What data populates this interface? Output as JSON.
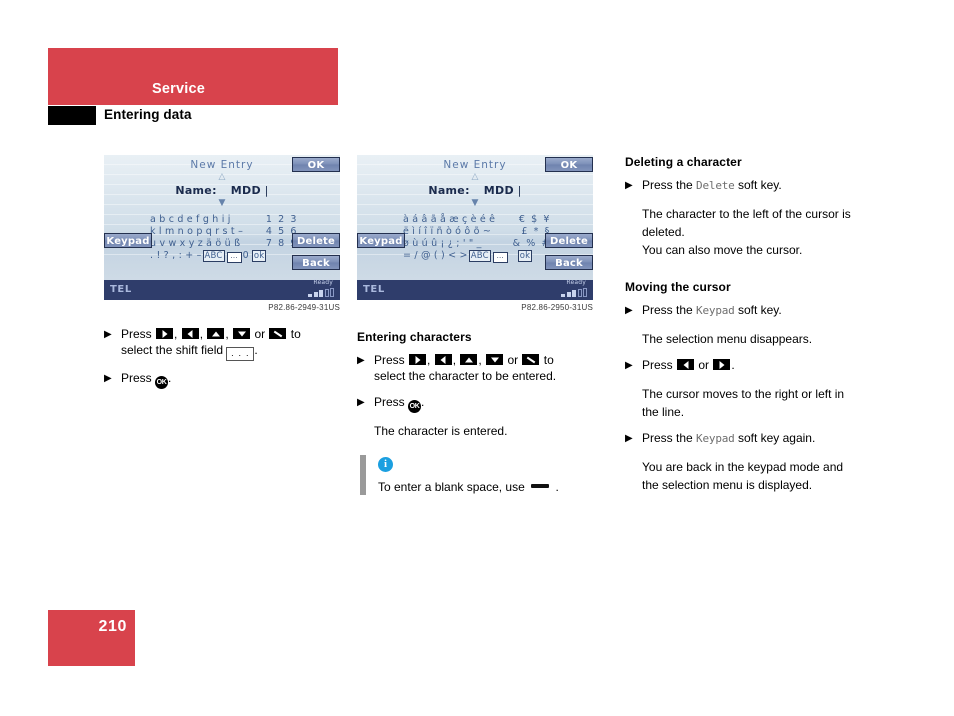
{
  "header": {
    "chapter": "Service",
    "section": "Entering data"
  },
  "footer": {
    "page_number": "210"
  },
  "colors": {
    "brand_red": "#d8434c",
    "screen_statusbar": "#2f3d6b",
    "screen_text_blue": "#3f5f8f",
    "info_icon_blue": "#1b9fe0"
  },
  "screens": [
    {
      "title": "New Entry",
      "up_arrow": "△",
      "down_arrow": "▼",
      "field_label": "Name:",
      "field_value": "MDD",
      "cursor": "|",
      "softkeys": {
        "ok": "OK",
        "delete": "Delete",
        "back": "Back",
        "keypad": "Keypad"
      },
      "char_rows": [
        {
          "letters": "a b c d e f g h i j",
          "digits": "1 2 3"
        },
        {
          "letters": "k l m n o p q r s t –",
          "digits": "4 5 6"
        },
        {
          "letters": "u v w x y z ä ö ü ß",
          "digits": "7 8 9"
        }
      ],
      "last_row": {
        "prefix": ". ! ? , : + –",
        "shift_label": "ABC",
        "dots": "...",
        "zero": "0",
        "ok": "ok"
      },
      "statusbar": {
        "mode": "TEL",
        "status": "Ready"
      },
      "caption": "P82.86-2949-31US"
    },
    {
      "title": "New Entry",
      "up_arrow": "△",
      "down_arrow": "▼",
      "field_label": "Name:",
      "field_value": "MDD",
      "cursor": "|",
      "softkeys": {
        "ok": "OK",
        "delete": "Delete",
        "back": "Back",
        "keypad": "Keypad"
      },
      "char_rows": [
        {
          "letters": "à á â ã å æ ç è é ê",
          "digits": "€ $ ¥"
        },
        {
          "letters": "ë ì í î ï ñ ò ó ô õ ~",
          "digits": "£ * §"
        },
        {
          "letters": "ø ù ú û ¡ ¿ ; ' \" _",
          "digits": "& % #"
        }
      ],
      "last_row": {
        "prefix": "= / @ ( ) < >",
        "shift_label": "ABC",
        "dots": "...",
        "zero": "",
        "ok": "ok"
      },
      "statusbar": {
        "mode": "TEL",
        "status": "Ready"
      },
      "caption": "P82.86-2950-31US"
    }
  ],
  "left_column": {
    "step1": {
      "press": "Press",
      "sep": ",",
      "or": "or",
      "to": "to",
      "line2_pre": "select the shift field",
      "shift_field": ". . .",
      "line2_post": "."
    },
    "step2": {
      "press": "Press",
      "ok_glyph": "OK",
      "period": "."
    }
  },
  "middle_column": {
    "heading": "Entering characters",
    "step1": {
      "press": "Press",
      "sep": ",",
      "or": "or",
      "to": "to",
      "line2": "select the character to be entered."
    },
    "step2": {
      "press": "Press",
      "ok_glyph": "OK",
      "period": "."
    },
    "result": "The character is entered.",
    "note": {
      "icon": "i",
      "text_pre": "To enter a blank space, use",
      "text_post": "."
    }
  },
  "right_column": {
    "section1": {
      "heading": "Deleting a character",
      "step1_pre": "Press the",
      "step1_key": "Delete",
      "step1_post": "soft key.",
      "result_line1": "The character to the left of the cursor is",
      "result_line2": "deleted.",
      "result_line3": "You can also move the cursor."
    },
    "section2": {
      "heading": "Moving the cursor",
      "step1_pre": "Press the",
      "step1_key": "Keypad",
      "step1_post": "soft key.",
      "result1": "The selection menu disappears.",
      "step2_pre": "Press",
      "step2_or": "or",
      "step2_post": ".",
      "result2_line1": "The cursor moves to the right or left in",
      "result2_line2": "the line.",
      "step3_pre": "Press the",
      "step3_key": "Keypad",
      "step3_post": "soft key again.",
      "result3_line1": "You are back in the keypad mode and",
      "result3_line2": "the selection menu is displayed."
    }
  }
}
